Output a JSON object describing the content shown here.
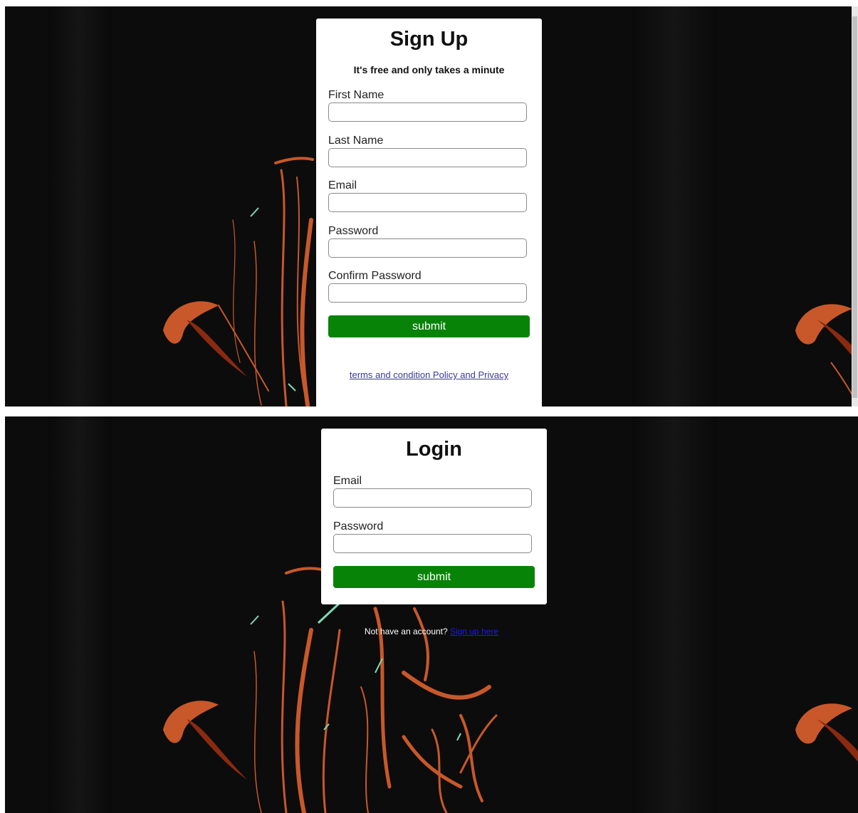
{
  "signup": {
    "title": "Sign Up",
    "subtitle": "It's free and only takes a minute",
    "fields": [
      {
        "label": "First Name",
        "value": ""
      },
      {
        "label": "Last Name",
        "value": ""
      },
      {
        "label": "Email",
        "value": ""
      },
      {
        "label": "Password",
        "value": ""
      },
      {
        "label": "Confirm Password",
        "value": ""
      }
    ],
    "submit_label": "submit",
    "terms_link": "terms and condition Policy and Privacy"
  },
  "login": {
    "title": "Login",
    "fields": [
      {
        "label": "Email",
        "value": ""
      },
      {
        "label": "Password",
        "value": ""
      }
    ],
    "submit_label": "submit",
    "signup_prompt": "Not have an account?",
    "signup_link": "Sign up here"
  },
  "colors": {
    "background": "#0d0d0d",
    "submit_button": "#078307",
    "link": "#1a1aff",
    "art_orange": "#c8582a",
    "art_teal": "#7fd8b4"
  }
}
